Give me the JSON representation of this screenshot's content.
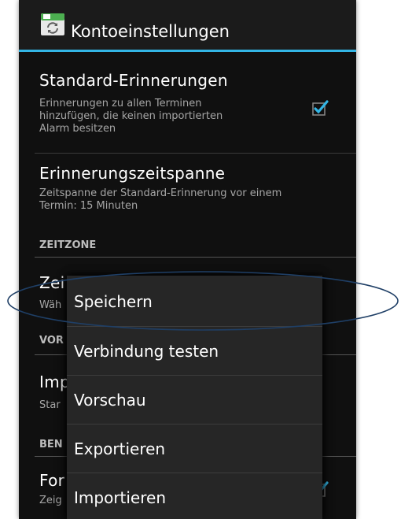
{
  "app": {
    "title": "Kontoeinstellungen",
    "accent_color": "#33b5e5",
    "icon": "calendar-sync-icon"
  },
  "prefs": {
    "standard_reminders": {
      "title": "Standard-Erinnerungen",
      "summary_lines": [
        "Erinnerungen zu allen Terminen",
        "hinzufügen, die keinen importierten",
        "Alarm besitzen"
      ],
      "checked": true
    },
    "reminder_span": {
      "title": "Erinnerungszeitspanne",
      "summary_lines": [
        "Zeitspanne der Standard-Erinnerung vor einem",
        "Termin: 15 Minuten"
      ]
    },
    "section_timezone": "ZEITZONE",
    "timezone": {
      "title": "Zei",
      "summary": "Wäh"
    },
    "section_2": "VOR",
    "import": {
      "title": "Imp",
      "summary": "Star"
    },
    "section_3": "BEN",
    "format": {
      "title": "For",
      "summary": "Zeig",
      "checked": true
    }
  },
  "menu": {
    "items": [
      "Speichern",
      "Verbindung testen",
      "Vorschau",
      "Exportieren",
      "Importieren"
    ]
  }
}
